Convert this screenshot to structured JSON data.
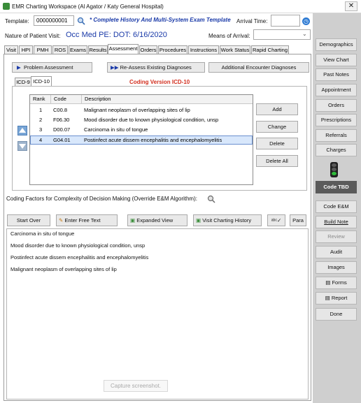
{
  "window": {
    "title": "EMR Charting Workspace (Al Agator / Katy General Hospital)",
    "close_label": "✕"
  },
  "header": {
    "template_label": "Template:",
    "template_value": "0000000001",
    "template_name": "* Complete History And Multi-System Exam Template",
    "arrival_time_label": "Arrival Time:",
    "arrival_time_value": "",
    "nature_label": "Nature of Patient Visit:",
    "nature_value": "Occ Med PE: DOT:  6/16/2020",
    "means_label": "Means of Arrival:",
    "means_value": ""
  },
  "tabs": [
    {
      "label": "Visit"
    },
    {
      "label": "HPI"
    },
    {
      "label": "PMH"
    },
    {
      "label": "ROS"
    },
    {
      "label": "Exams"
    },
    {
      "label": "Results"
    },
    {
      "label": "Assessment",
      "active": true
    },
    {
      "label": "Orders"
    },
    {
      "label": "Procedures"
    },
    {
      "label": "Instructions"
    },
    {
      "label": "Work Status"
    },
    {
      "label": "Rapid Charting"
    }
  ],
  "assessment": {
    "problem_assessment": "Problem Assessment",
    "reassess": "Re-Assess Existing Diagnoses",
    "additional_dx": "Additional Encounter Diagnoses",
    "subtab_icd9": "ICD-9",
    "subtab_icd10": "ICD-10",
    "coding_version": "Coding Version ICD-10",
    "columns": [
      "Rank",
      "Code",
      "Description"
    ],
    "rows": [
      {
        "rank": "1",
        "code": "C00.8",
        "description": "Malignant neoplasm of overlapping sites of lip"
      },
      {
        "rank": "2",
        "code": "F06.30",
        "description": "Mood disorder due to known physiological condition, unsp"
      },
      {
        "rank": "3",
        "code": "D00.07",
        "description": "Carcinoma in situ of tongue"
      },
      {
        "rank": "4",
        "code": "G04.01",
        "description": "Postinfect acute dissem encephalitis and encephalomyelitis",
        "selected": true
      }
    ],
    "add": "Add",
    "change": "Change",
    "delete": "Delete",
    "delete_all": "Delete All",
    "coding_factors": "Coding Factors for Complexity of Decision Making (Override E&M Algorithm):",
    "start_over": "Start Over",
    "free_text": "Enter Free Text",
    "expanded_view": "Expanded View",
    "visit_history": "Visit Charting History",
    "para": "Para",
    "notes": [
      "Carcinoma in situ of tongue",
      "Mood disorder due to known physiological condition, unsp",
      "Postinfect acute dissem encephalitis and encephalomyelitis",
      "Malignant neoplasm of overlapping sites of lip"
    ],
    "capture_text": "Capture screenshot."
  },
  "sidebar": {
    "demographics": "Demographics",
    "view_chart": "View Chart",
    "past_notes": "Past Notes",
    "appointment": "Appointment",
    "orders": "Orders",
    "prescriptions": "Prescriptions",
    "referrals": "Referrals",
    "charges": "Charges",
    "code_tbd": "Code TBD",
    "code_em": "Code E&M",
    "build_note": "Build Note",
    "review": "Review",
    "audit": "Audit",
    "images": "Images",
    "forms": "Forms",
    "report": "Report",
    "done": "Done"
  }
}
